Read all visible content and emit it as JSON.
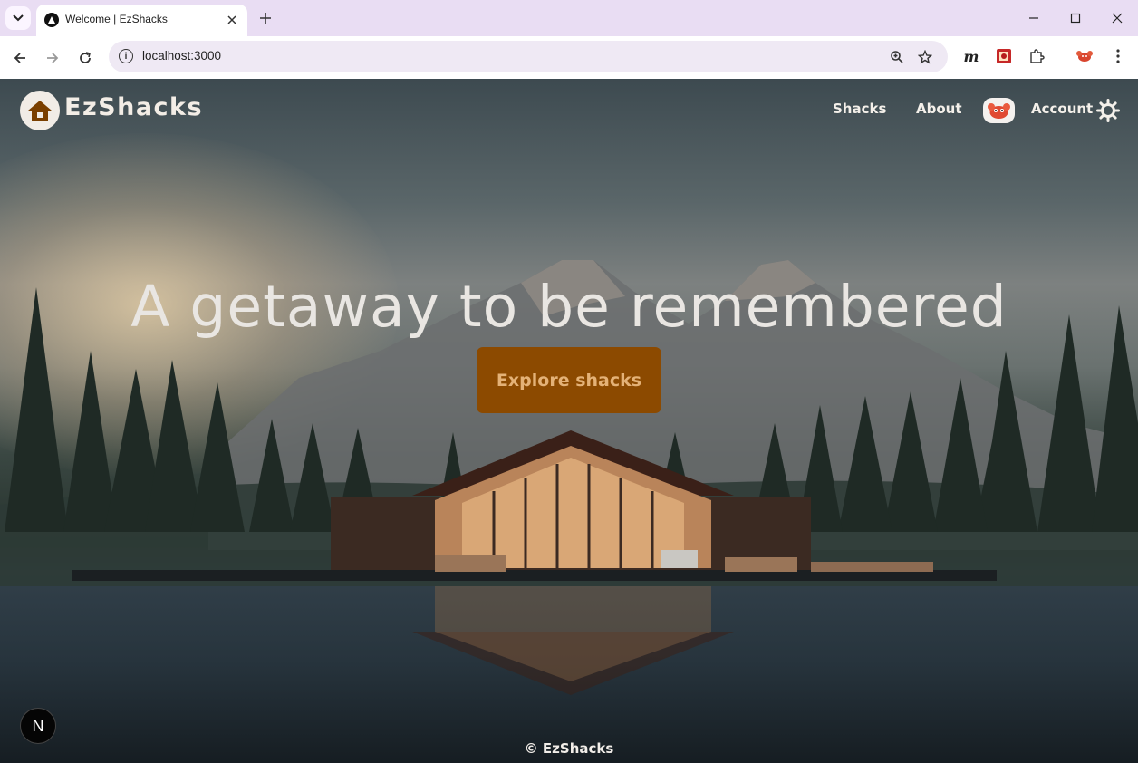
{
  "browser": {
    "tab_title": "Welcome | EzShacks",
    "url": "localhost:3000",
    "icons": [
      "tab-search-icon",
      "close-icon",
      "plus-icon",
      "minimize-icon",
      "maximize-icon",
      "close-window-icon",
      "back-icon",
      "forward-icon",
      "reload-icon",
      "info-icon",
      "zoom-icon",
      "star-icon",
      "extension-m-icon",
      "extension-red-icon",
      "puzzle-icon",
      "profile-avatar-icon",
      "kebab-menu-icon"
    ]
  },
  "site": {
    "brand": "EzShacks",
    "nav": {
      "shacks": "Shacks",
      "about": "About",
      "account": "Account"
    },
    "hero_title": "A getaway to be remembered",
    "cta_label": "Explore shacks",
    "footer": "© EzShacks",
    "next_badge": "N",
    "colors": {
      "accent": "#8c4a00",
      "accent_text": "#e4b277",
      "logo_bg": "#f1ece6",
      "logo_house": "#7a3f00"
    }
  }
}
